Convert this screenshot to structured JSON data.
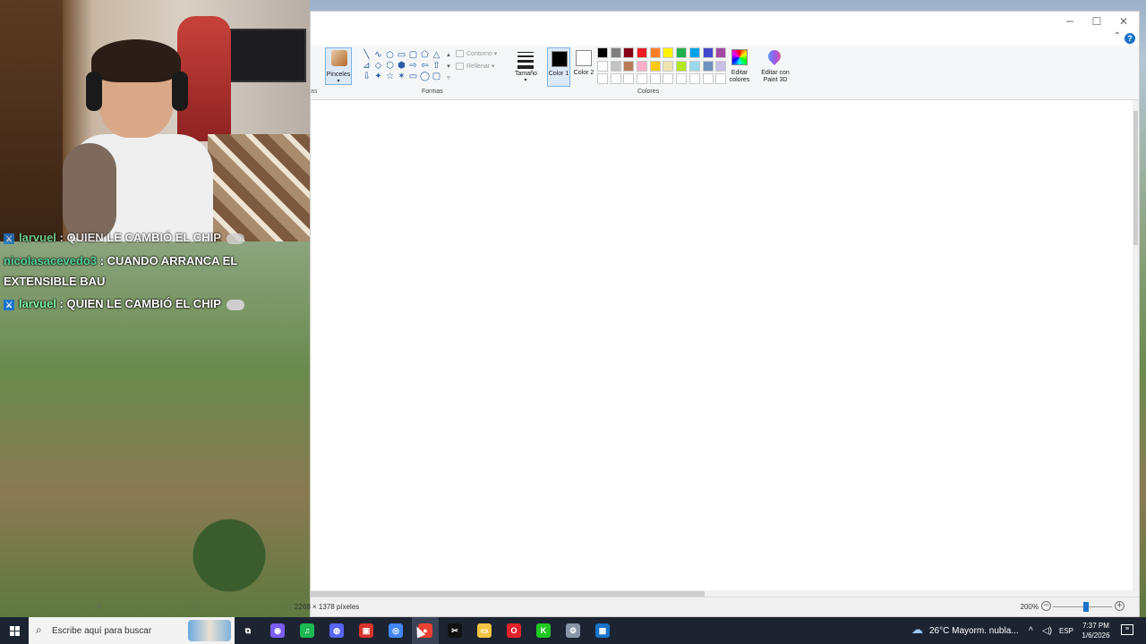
{
  "paint": {
    "window_controls": {
      "minimize": "─",
      "maximize": "☐",
      "close": "✕"
    },
    "help_icon": "?",
    "ribbon": {
      "partial_group_label": "as",
      "brushes_label": "Pinceles",
      "shapes_group_label": "Formas",
      "outline_label": "Contorno",
      "fill_label": "Rellenar",
      "size_label": "Tamaño",
      "color1_label": "Color 1",
      "color2_label": "Color 2",
      "colors_group_label": "Colores",
      "edit_colors_label": "Editar colores",
      "edit_paint3d_label": "Editar con Paint 3D",
      "shapes": [
        "╲",
        "∿",
        "○",
        "▭",
        "▢",
        "⬠",
        "△",
        "⊿",
        "◇",
        "⬡",
        "⬢",
        "⇨",
        "⇦",
        "⇧",
        "⇩",
        "✦",
        "☆",
        "✶",
        "▭",
        "◯",
        "▢"
      ],
      "color1": "#000000",
      "color2": "#ffffff",
      "palette": [
        "#000000",
        "#7f7f7f",
        "#880015",
        "#ed1c24",
        "#ff7f27",
        "#fff200",
        "#22b14c",
        "#00a2e8",
        "#3f48cc",
        "#a349a4",
        "#ffffff",
        "#c3c3c3",
        "#b97a57",
        "#ffaec9",
        "#ffc90e",
        "#efe4b0",
        "#b5e61d",
        "#99d9ea",
        "#7092be",
        "#c8bfe7",
        "#ffffff",
        "#ffffff",
        "#ffffff",
        "#ffffff",
        "#ffffff",
        "#ffffff",
        "#ffffff",
        "#ffffff",
        "#ffffff",
        "#ffffff"
      ]
    },
    "status": {
      "dimensions": "2268 × 1378 píxeles",
      "zoom": "200%"
    }
  },
  "chat": {
    "messages": [
      {
        "user": "larvuel",
        "text": ": QUIEN LE CAMBIÓ EL CHIP",
        "badge": "⚔"
      },
      {
        "user": "nicolasacevedo3",
        "text": ": CUANDO ARRANCA EL",
        "continuation": "EXTENSIBLE BAU"
      },
      {
        "user": "larvuel",
        "text": ": QUIEN LE CAMBIÓ EL CHIP",
        "badge": "⚔"
      }
    ]
  },
  "taskbar": {
    "search_placeholder": "Escribe aquí para buscar",
    "weather": "26°C  Mayorm. nubla...",
    "language": "ESP",
    "time": "7:37 PM",
    "date": "1/6/2026",
    "apps": [
      {
        "name": "task-view-icon",
        "glyph": "⧉",
        "color": "#1c2432"
      },
      {
        "name": "copilot-icon",
        "glyph": "◉",
        "color": "#7a5cf0"
      },
      {
        "name": "spotify-icon",
        "glyph": "♫",
        "color": "#1db954"
      },
      {
        "name": "discord-icon",
        "glyph": "◍",
        "color": "#5865f2"
      },
      {
        "name": "media-app-icon",
        "glyph": "▣",
        "color": "#d8342c"
      },
      {
        "name": "chrome-icon",
        "glyph": "◎",
        "color": "#4285f4"
      },
      {
        "name": "recorder-icon",
        "glyph": "●",
        "color": "#ea4335"
      },
      {
        "name": "capcut-icon",
        "glyph": "✂",
        "color": "#111111"
      },
      {
        "name": "file-explorer-icon",
        "glyph": "▭",
        "color": "#f4c542"
      },
      {
        "name": "opera-icon",
        "glyph": "O",
        "color": "#e3222c"
      },
      {
        "name": "kick-icon",
        "glyph": "K",
        "color": "#21c821"
      },
      {
        "name": "game-icon",
        "glyph": "⚙",
        "color": "#8a96a8"
      },
      {
        "name": "calculator-icon",
        "glyph": "▦",
        "color": "#1a73c8"
      }
    ]
  }
}
